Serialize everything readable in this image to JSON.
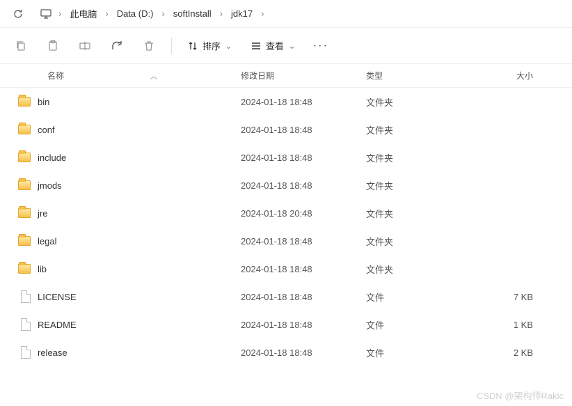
{
  "breadcrumb": {
    "items": [
      {
        "label": "此电脑"
      },
      {
        "label": "Data (D:)"
      },
      {
        "label": "softInstall"
      },
      {
        "label": "jdk17"
      }
    ]
  },
  "toolbar": {
    "sort_label": "排序",
    "view_label": "查看"
  },
  "columns": {
    "name": "名称",
    "date": "修改日期",
    "type": "类型",
    "size": "大小"
  },
  "type_labels": {
    "folder": "文件夹",
    "file": "文件"
  },
  "files": [
    {
      "name": "bin",
      "date": "2024-01-18 18:48",
      "type": "folder",
      "size": ""
    },
    {
      "name": "conf",
      "date": "2024-01-18 18:48",
      "type": "folder",
      "size": ""
    },
    {
      "name": "include",
      "date": "2024-01-18 18:48",
      "type": "folder",
      "size": ""
    },
    {
      "name": "jmods",
      "date": "2024-01-18 18:48",
      "type": "folder",
      "size": ""
    },
    {
      "name": "jre",
      "date": "2024-01-18 20:48",
      "type": "folder",
      "size": ""
    },
    {
      "name": "legal",
      "date": "2024-01-18 18:48",
      "type": "folder",
      "size": ""
    },
    {
      "name": "lib",
      "date": "2024-01-18 18:48",
      "type": "folder",
      "size": ""
    },
    {
      "name": "LICENSE",
      "date": "2024-01-18 18:48",
      "type": "file",
      "size": "7 KB"
    },
    {
      "name": "README",
      "date": "2024-01-18 18:48",
      "type": "file",
      "size": "1 KB"
    },
    {
      "name": "release",
      "date": "2024-01-18 18:48",
      "type": "file",
      "size": "2 KB"
    }
  ],
  "watermark": "CSDN @架构师Rakic"
}
